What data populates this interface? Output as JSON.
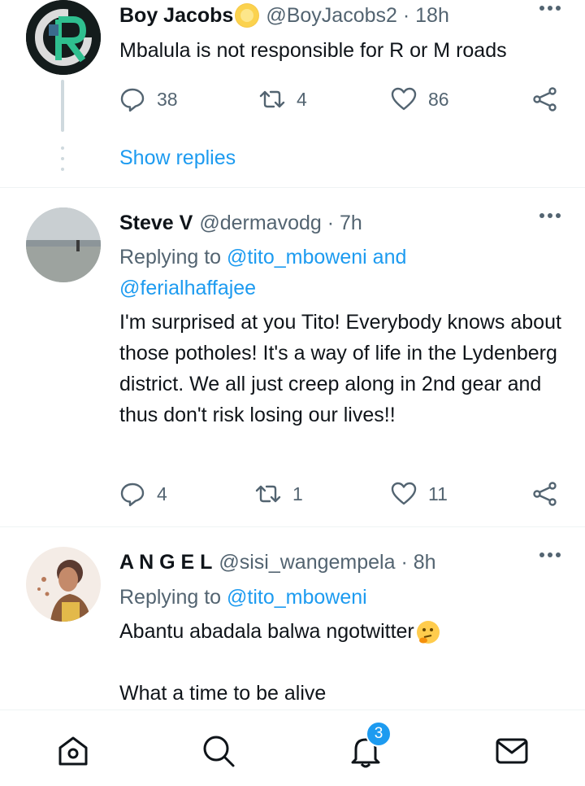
{
  "tweets": [
    {
      "name": "Boy Jacobs",
      "handle": "@BoyJacobs2 · 18h",
      "text": "Mbalula is not responsible for R or M roads",
      "replies": "38",
      "retweets": "4",
      "likes": "86",
      "show_replies": "Show replies"
    },
    {
      "name": "Steve V",
      "handle": "@dermavodg · 7h",
      "replying_prefix": "Replying to",
      "replying_to_1": "@tito_mboweni",
      "replying_and": "and",
      "replying_to_2": "@ferialhaffajee",
      "text": "I'm surprised at you Tito! Everybody knows about those potholes! It's a way of life in the Lydenberg district. We all just creep along in 2nd gear and thus don't risk losing our lives!!",
      "replies": "4",
      "retweets": "1",
      "likes": "11"
    },
    {
      "name": "A N G E L",
      "handle": "@sisi_wangempela · 8h",
      "replying_prefix": "Replying to",
      "replying_to_1": "@tito_mboweni",
      "text_line1": "Abantu abadala balwa ngotwitter",
      "text_line2": "What a time to be alive"
    }
  ],
  "nav": {
    "notification_count": "3",
    "items": [
      "home-icon",
      "search-icon",
      "notifications-icon",
      "messages-icon"
    ]
  },
  "colors": {
    "accent": "#1d9bf0",
    "secondary_text": "#536471",
    "primary_text": "#0f1419"
  }
}
